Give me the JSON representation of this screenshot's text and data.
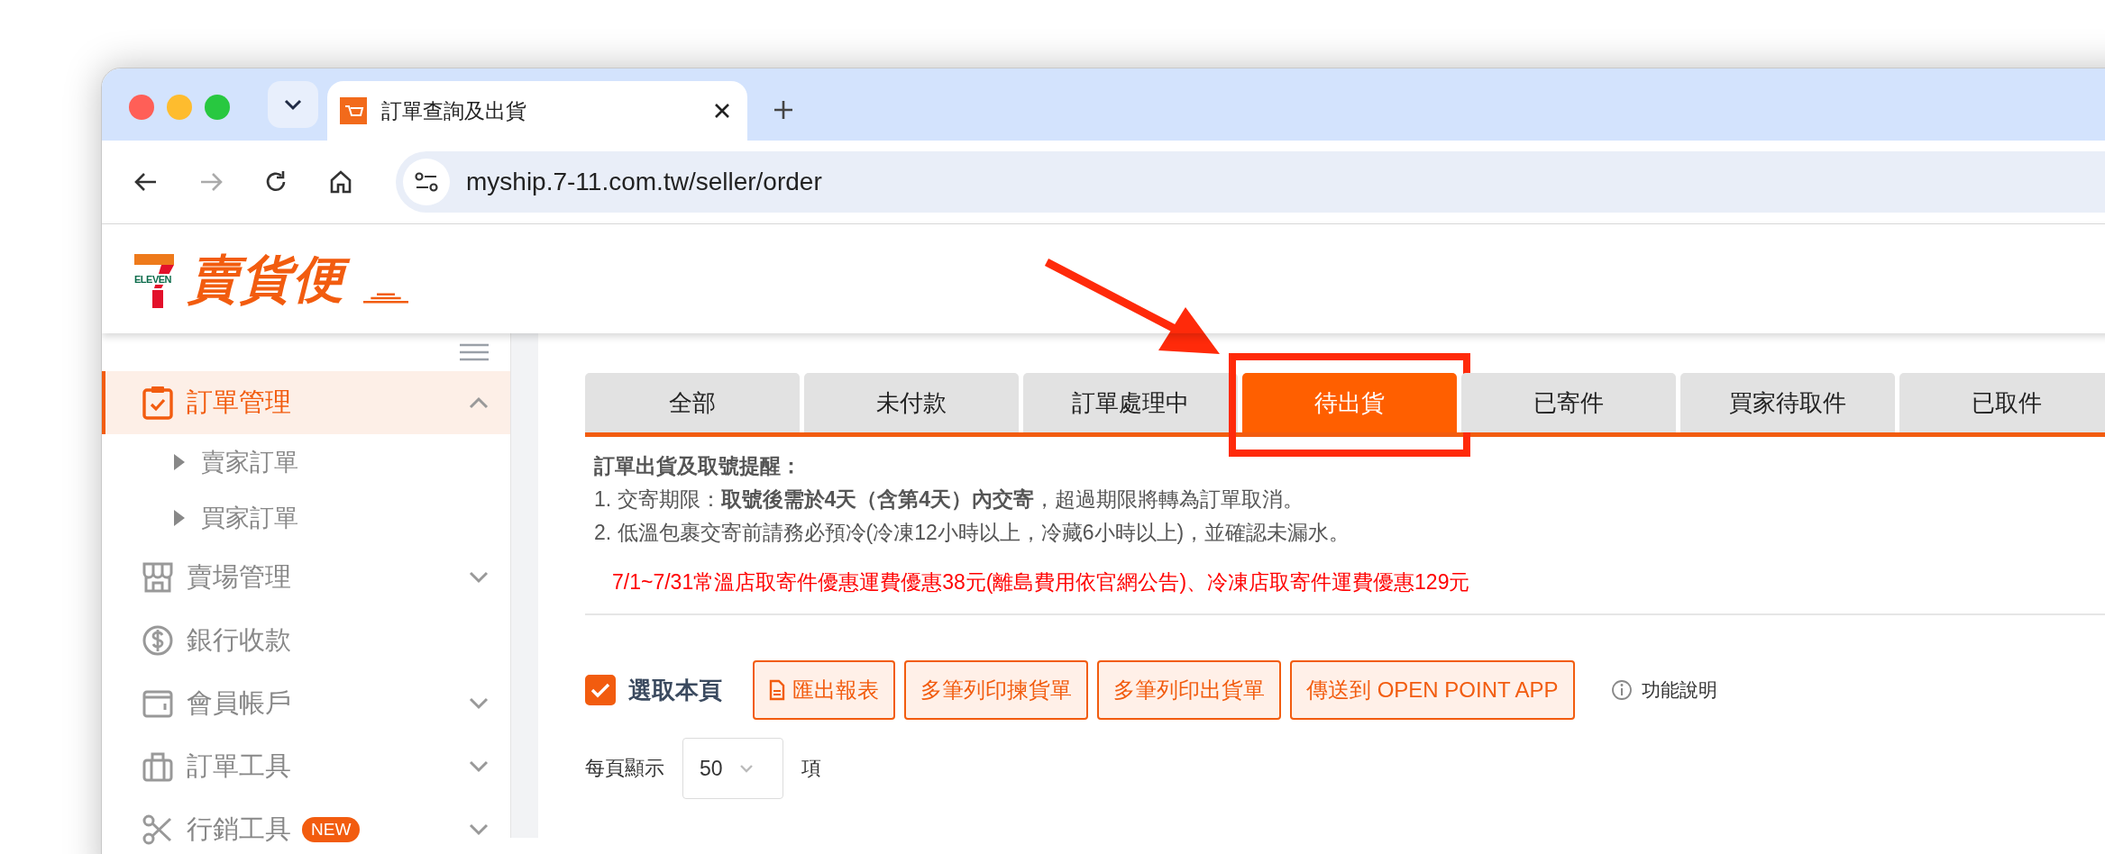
{
  "browser": {
    "tab_title": "訂單查詢及出貨",
    "url": "myship.7-11.com.tw/seller/order"
  },
  "logo": {
    "brand": "ELEVEN",
    "name": "賣貨便"
  },
  "sidebar": {
    "items": [
      {
        "kind": "group",
        "label": "訂單管理",
        "selected": true,
        "expanded": true,
        "children": [
          {
            "label": "賣家訂單"
          },
          {
            "label": "買家訂單"
          }
        ]
      },
      {
        "kind": "group",
        "label": "賣場管理",
        "selected": false,
        "expanded": false
      },
      {
        "kind": "link",
        "label": "銀行收款",
        "selected": false
      },
      {
        "kind": "group",
        "label": "會員帳戶",
        "selected": false,
        "expanded": false
      },
      {
        "kind": "group",
        "label": "訂單工具",
        "selected": false,
        "expanded": false
      },
      {
        "kind": "group",
        "label": "行銷工具",
        "selected": false,
        "expanded": false,
        "badge": "NEW"
      }
    ]
  },
  "tabs": [
    {
      "label": "全部",
      "selected": false
    },
    {
      "label": "未付款",
      "selected": false
    },
    {
      "label": "訂單處理中",
      "selected": false
    },
    {
      "label": "待出貨",
      "selected": true
    },
    {
      "label": "已寄件",
      "selected": false
    },
    {
      "label": "買家待取件",
      "selected": false
    },
    {
      "label": "已取件",
      "selected": false
    }
  ],
  "notice": {
    "title": "訂單出貨及取號提醒：",
    "lines": [
      "1. 交寄期限：**取號後需於4天（含第4天）內交寄**，超過期限將轉為訂單取消。",
      "2. 低溫包裹交寄前請務必預冷(冷凍12小時以上，冷藏6小時以上)，並確認未漏水。"
    ],
    "promo": "7/1~7/31常溫店取寄件優惠運費優惠38元(離島費用依官網公告)、冷凍店取寄件運費優惠129元"
  },
  "actions": {
    "select_page": {
      "label": "選取本頁",
      "checked": true
    },
    "buttons": [
      {
        "label": "匯出報表",
        "kind": "export"
      },
      {
        "label": "多筆列印揀貨單",
        "kind": "plain"
      },
      {
        "label": "多筆列印出貨單",
        "kind": "plain"
      },
      {
        "label": "傳送到 OPEN POINT APP",
        "kind": "plain"
      }
    ],
    "help": "功能說明"
  },
  "per_page": {
    "label": "每頁顯示",
    "value": "50",
    "unit": "項"
  }
}
